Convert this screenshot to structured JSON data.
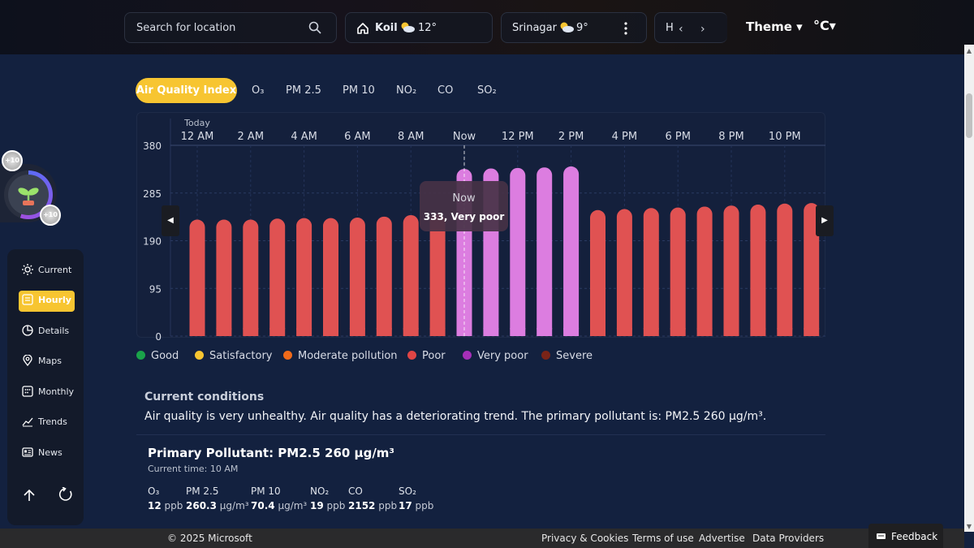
{
  "topbar": {
    "search_placeholder": "Search for location",
    "locations": [
      {
        "name": "Koil",
        "temp": "12°",
        "icon": "partly-cloudy-icon"
      },
      {
        "name": "Srinagar",
        "temp": "9°",
        "icon": "partly-cloudy-icon"
      },
      {
        "name": "H",
        "temp": ""
      }
    ],
    "theme_label": "Theme ▾",
    "unit_label": "°C▾"
  },
  "reward": {
    "badge_top": "+10",
    "badge_bottom": "+10"
  },
  "sidebar": {
    "items": [
      {
        "label": "Current",
        "icon": "sun-icon"
      },
      {
        "label": "Hourly",
        "icon": "hourly-icon",
        "active": true
      },
      {
        "label": "Details",
        "icon": "pie-icon"
      },
      {
        "label": "Maps",
        "icon": "map-pin-icon"
      },
      {
        "label": "Monthly",
        "icon": "calendar-icon"
      },
      {
        "label": "Trends",
        "icon": "trend-icon"
      },
      {
        "label": "News",
        "icon": "news-icon"
      }
    ]
  },
  "tabs": [
    "Air Quality Index",
    "O₃",
    "PM 2.5",
    "PM 10",
    "NO₂",
    "CO",
    "SO₂"
  ],
  "chart_data": {
    "type": "bar",
    "day_label": "Today",
    "x_tick_labels": [
      "12 AM",
      "2 AM",
      "4 AM",
      "6 AM",
      "8 AM",
      "Now",
      "12 PM",
      "2 PM",
      "4 PM",
      "6 PM",
      "8 PM",
      "10 PM"
    ],
    "y_ticks": [
      0,
      95,
      190,
      285,
      380
    ],
    "ylim": [
      0,
      380
    ],
    "values": [
      232,
      232,
      232,
      234,
      235,
      235,
      236,
      238,
      241,
      243,
      333,
      334,
      335,
      336,
      338,
      251,
      253,
      255,
      256,
      258,
      260,
      262,
      264,
      265
    ],
    "colors": [
      "#e05252",
      "#e05252",
      "#e05252",
      "#e05252",
      "#e05252",
      "#e05252",
      "#e05252",
      "#e05252",
      "#e05252",
      "#e05252",
      "#dc7de0",
      "#dc7de0",
      "#dc7de0",
      "#dc7de0",
      "#dc7de0",
      "#e05252",
      "#e05252",
      "#e05252",
      "#e05252",
      "#e05252",
      "#e05252",
      "#e05252",
      "#e05252",
      "#e05252"
    ],
    "now_index": 10,
    "tooltip": {
      "time": "Now",
      "value": "333, Very poor"
    }
  },
  "legend": [
    {
      "label": "Good",
      "color": "#1aa34a"
    },
    {
      "label": "Satisfactory",
      "color": "#f7c531"
    },
    {
      "label": "Moderate pollution",
      "color": "#f06a1a"
    },
    {
      "label": "Poor",
      "color": "#e04545"
    },
    {
      "label": "Very poor",
      "color": "#a52fb8"
    },
    {
      "label": "Severe",
      "color": "#7a2418"
    }
  ],
  "conditions": {
    "title": "Current conditions",
    "text": "Air quality is very unhealthy. Air quality has a deteriorating trend. The primary pollutant is: PM2.5 260 µg/m³."
  },
  "primary": {
    "title": "Primary Pollutant: PM2.5 260 µg/m³",
    "time": "Current time: 10 AM",
    "pollutants": [
      {
        "name": "O₃",
        "value": "12",
        "unit": "ppb"
      },
      {
        "name": "PM 2.5",
        "value": "260.3",
        "unit": "µg/m³"
      },
      {
        "name": "PM 10",
        "value": "70.4",
        "unit": "µg/m³"
      },
      {
        "name": "NO₂",
        "value": "19",
        "unit": "ppb"
      },
      {
        "name": "CO",
        "value": "2152",
        "unit": "ppb"
      },
      {
        "name": "SO₂",
        "value": "17",
        "unit": "ppb"
      }
    ]
  },
  "footer": {
    "copyright": "© 2025 Microsoft",
    "links": [
      "Privacy & Cookies",
      "Terms of use",
      "Advertise",
      "Data Providers"
    ],
    "feedback": "Feedback"
  },
  "colors": {
    "accent": "#f7c531",
    "background": "#13213f",
    "poor_bar": "#e05252",
    "very_poor_bar": "#dc7de0"
  }
}
